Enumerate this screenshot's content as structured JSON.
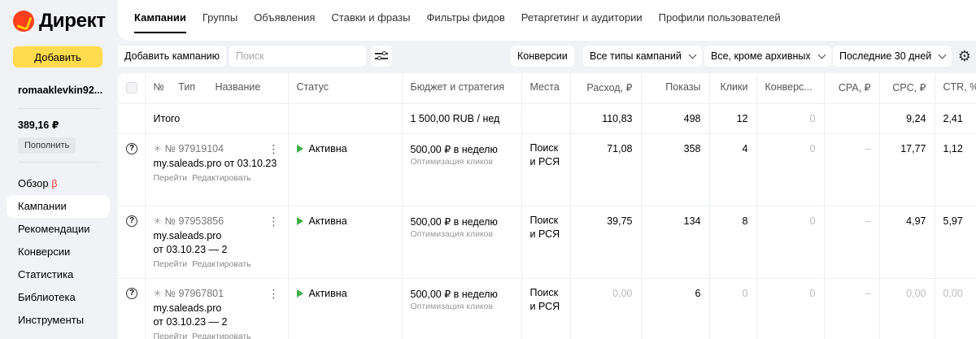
{
  "app": {
    "logo_text": "Директ"
  },
  "sidebar": {
    "add_label": "Добавить",
    "user": "romaaklevkin92...",
    "balance": "389,16 ₽",
    "topup_label": "Пополнить",
    "nav": [
      {
        "label": "Обзор",
        "badge": "β"
      },
      {
        "label": "Кампании",
        "active": true
      },
      {
        "label": "Рекомендации"
      },
      {
        "label": "Конверсии"
      },
      {
        "label": "Статистика"
      },
      {
        "label": "Библиотека"
      },
      {
        "label": "Инструменты"
      }
    ]
  },
  "tabs": [
    "Кампании",
    "Группы",
    "Объявления",
    "Ставки и фразы",
    "Фильтры фидов",
    "Ретаргетинг и аудитории",
    "Профили пользователей"
  ],
  "toolbar": {
    "add_campaign": "Добавить кампанию",
    "search_placeholder": "Поиск",
    "conversions": "Конверсии",
    "campaign_types": "Все типы кампаний",
    "archive_filter": "Все, кроме архивных",
    "period": "Последние 30 дней"
  },
  "table": {
    "headers": {
      "num": "№",
      "type": "Тип",
      "name": "Название",
      "status": "Статус",
      "budget": "Бюджет и стратегия",
      "places": "Места",
      "spend": "Расход, ₽",
      "impressions": "Показы",
      "clicks": "Клики",
      "conversions": "Конверс...",
      "cpa": "CPA, ₽",
      "cpc": "CPC, ₽",
      "ctr": "CTR, %"
    },
    "total": {
      "label": "Итого",
      "budget": "1 500,00 RUB / нед",
      "spend": "110,83",
      "impressions": "498",
      "clicks": "12",
      "conversions": "0",
      "cpc": "9,24",
      "ctr": "2,41"
    },
    "rows": [
      {
        "id": "№ 97919104",
        "name_line1": "my.saleads.pro от 03.10.23",
        "name_line2": "",
        "go": "Перейти",
        "edit": "Редактировать",
        "status": "Активна",
        "budget": "500,00 ₽ в неделю",
        "strategy": "Оптимизация кликов",
        "places_1": "Поиск",
        "places_2": "и РСЯ",
        "spend": "71,08",
        "impressions": "358",
        "clicks": "4",
        "conversions": "0",
        "cpa": "–",
        "cpc": "17,77",
        "ctr": "1,12"
      },
      {
        "id": "№ 97953856",
        "name_line1": "my.saleads.pro",
        "name_line2": "от 03.10.23 — 2",
        "go": "Перейти",
        "edit": "Редактировать",
        "status": "Активна",
        "budget": "500,00 ₽ в неделю",
        "strategy": "Оптимизация кликов",
        "places_1": "Поиск",
        "places_2": "и РСЯ",
        "spend": "39,75",
        "impressions": "134",
        "clicks": "8",
        "conversions": "0",
        "cpa": "–",
        "cpc": "4,97",
        "ctr": "5,97"
      },
      {
        "id": "№ 97967801",
        "name_line1": "my.saleads.pro",
        "name_line2": "от 03.10.23 — 2",
        "go": "Перейти",
        "edit": "Редактировать",
        "status": "Активна",
        "budget": "500,00 ₽ в неделю",
        "strategy": "Оптимизация кликов",
        "places_1": "Поиск",
        "places_2": "и РСЯ",
        "spend": "0,00",
        "impressions": "6",
        "clicks": "0",
        "conversions": "0",
        "cpa": "–",
        "cpc": "0,00",
        "ctr": "0,00"
      }
    ]
  },
  "colors": {
    "accent": "#ffdb4d",
    "active_status": "#3cb043",
    "beta": "#ee3333"
  }
}
